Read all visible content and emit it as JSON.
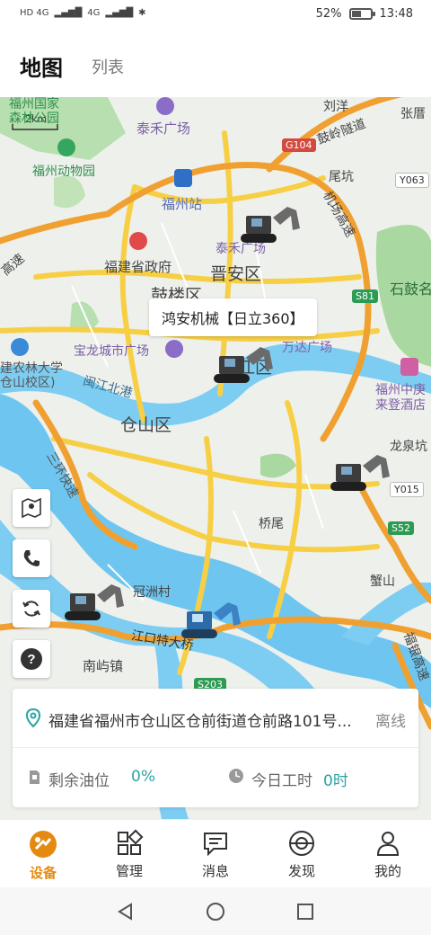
{
  "status_bar": {
    "signal_left": "HD 4G",
    "signal_right": "4G",
    "battery_text": "52%",
    "battery_level": 0.52,
    "time": "13:48"
  },
  "header": {
    "tabs": [
      {
        "label": "地图",
        "active": true
      },
      {
        "label": "列表",
        "active": false
      }
    ]
  },
  "map": {
    "scale": "2km",
    "labels": {
      "park": "福州国家\n森林公园",
      "taihe_top": "泰禾广场",
      "zoo": "福州动物园",
      "fuzhou_station": "福州站",
      "government": "福建省政府",
      "taihe_mid": "泰禾广场",
      "jinan": "晋安区",
      "gulou": "鼓楼区",
      "baolong": "宝龙城市广场",
      "wanda": "万达广场",
      "minjiang_north": "闽江北港",
      "cangshan": "仓山区",
      "taijiang": "台江区",
      "agri_univ": "建农林大学\n仓山校区)",
      "sanjiang": "三环快速",
      "qiaowei": "桥尾",
      "guanzhou": "冠洲村",
      "jiangkou": "江口特大桥",
      "nanyu": "南屿镇",
      "xieshan": "蟹山",
      "longquan": "龙泉坑",
      "fuzhou_zhongjing": "福州中庚\n来登酒店",
      "shigu": "石鼓名",
      "liuyang": "刘洋",
      "zhangcuo": "张厝",
      "guling": "鼓岭隧道",
      "jichang": "机场高速",
      "weikeng": "尾坑",
      "fuyin": "福银高速",
      "gaosu": "高速"
    },
    "road_badges": {
      "g104": "G104",
      "y063": "Y063",
      "s81": "S81",
      "y015": "Y015",
      "s52": "S52",
      "s203": "S203"
    },
    "tooltip": "鸿安机械【日立360】"
  },
  "side_buttons": {
    "map_pin_icon": "map-pin-icon",
    "phone_icon": "phone-icon",
    "refresh_icon": "refresh-icon",
    "help_icon": "help-icon"
  },
  "info_card": {
    "address": "福建省福州市仓山区仓前街道仓前路101号...",
    "status": "离线",
    "fuel_label": "剩余油位",
    "fuel_value": "0%",
    "work_label": "今日工时",
    "work_value": "0时"
  },
  "bottom_nav": [
    {
      "label": "设备",
      "active": true,
      "icon": "device-icon"
    },
    {
      "label": "管理",
      "active": false,
      "icon": "grid-icon"
    },
    {
      "label": "消息",
      "active": false,
      "icon": "message-icon"
    },
    {
      "label": "发现",
      "active": false,
      "icon": "discover-icon"
    },
    {
      "label": "我的",
      "active": false,
      "icon": "user-icon"
    }
  ],
  "colors": {
    "accent": "#e58a11",
    "teal": "#2aa4a4",
    "water": "#6ec6f0",
    "road_yellow": "#f7cf45",
    "road_orange": "#f0a030",
    "park_green": "#a9d9a0"
  }
}
